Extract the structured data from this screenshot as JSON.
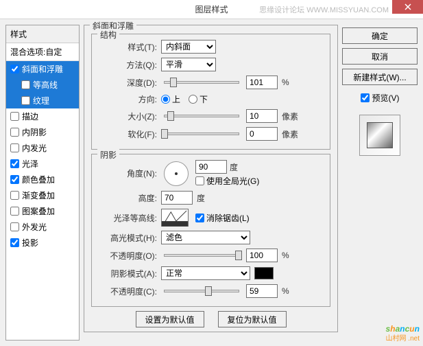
{
  "window": {
    "title": "图层样式",
    "watermark": "思缘设计论坛 WWW.MISSYUAN.COM"
  },
  "styleList": {
    "header": "样式",
    "subheader": "混合选项:自定",
    "items": [
      {
        "label": "斜面和浮雕",
        "checked": true,
        "selected": true
      },
      {
        "label": "等高线",
        "checked": false,
        "sub": true,
        "selected": true
      },
      {
        "label": "纹理",
        "checked": false,
        "sub": true,
        "selected": true
      },
      {
        "label": "描边",
        "checked": false
      },
      {
        "label": "内阴影",
        "checked": false
      },
      {
        "label": "内发光",
        "checked": false
      },
      {
        "label": "光泽",
        "checked": true
      },
      {
        "label": "颜色叠加",
        "checked": true
      },
      {
        "label": "渐变叠加",
        "checked": false
      },
      {
        "label": "图案叠加",
        "checked": false
      },
      {
        "label": "外发光",
        "checked": false
      },
      {
        "label": "投影",
        "checked": true
      }
    ]
  },
  "bevel": {
    "title": "斜面和浮雕",
    "structure": {
      "title": "结构",
      "styleLabel": "样式(T):",
      "styleValue": "内斜面",
      "methodLabel": "方法(Q):",
      "methodValue": "平滑",
      "depthLabel": "深度(D):",
      "depthValue": "101",
      "depthUnit": "%",
      "directionLabel": "方向:",
      "upLabel": "上",
      "downLabel": "下",
      "sizeLabel": "大小(Z):",
      "sizeValue": "10",
      "sizeUnit": "像素",
      "softenLabel": "软化(F):",
      "softenValue": "0",
      "softenUnit": "像素"
    },
    "shading": {
      "title": "阴影",
      "angleLabel": "角度(N):",
      "angleValue": "90",
      "angleUnit": "度",
      "globalLabel": "使用全局光(G)",
      "altitudeLabel": "高度:",
      "altitudeValue": "70",
      "altitudeUnit": "度",
      "glossLabel": "光泽等高线:",
      "antialiasLabel": "消除锯齿(L)",
      "highlightLabel": "高光模式(H):",
      "highlightMode": "滤色",
      "hOpacityLabel": "不透明度(O):",
      "hOpacityValue": "100",
      "hOpacityUnit": "%",
      "shadowLabel": "阴影模式(A):",
      "shadowMode": "正常",
      "sOpacityLabel": "不透明度(C):",
      "sOpacityValue": "59",
      "sOpacityUnit": "%"
    },
    "defaultBtn": "设置为默认值",
    "resetBtn": "复位为默认值"
  },
  "buttons": {
    "ok": "确定",
    "cancel": "取消",
    "newStyle": "新建样式(W)...",
    "preview": "预览(V)"
  },
  "logo": {
    "text": "shancun",
    "sub": "山村网 .net"
  }
}
